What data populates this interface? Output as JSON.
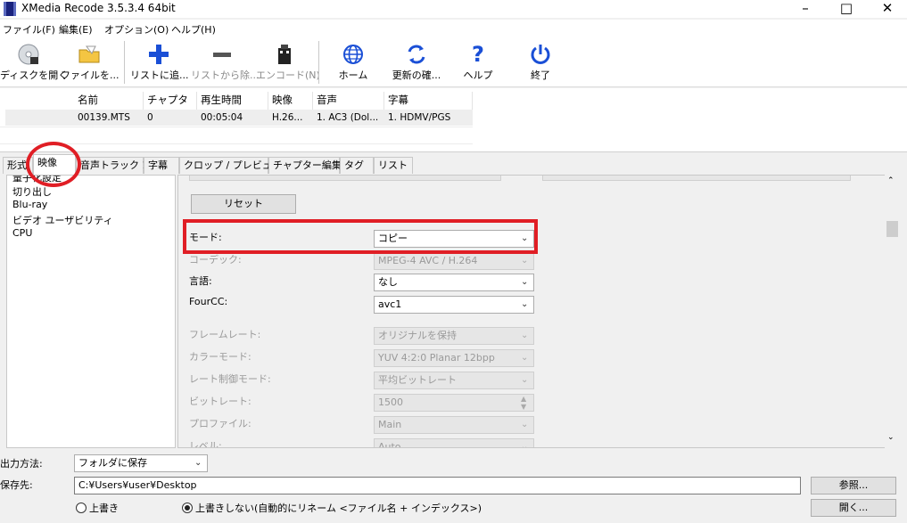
{
  "window": {
    "title": "XMedia Recode 3.5.3.4 64bit"
  },
  "menu": [
    "ファイル(F)",
    "編集(E)",
    "オプション(O)",
    "ヘルプ(H)"
  ],
  "toolbar": {
    "open_disc": "ディスクを開く",
    "open_file": "ファイルを...",
    "add_list": "リストに追...",
    "remove_list": "リストから除...",
    "encode": "エンコード(N)",
    "home": "ホーム",
    "update": "更新の確...",
    "help": "ヘルプ",
    "exit": "終了"
  },
  "filelist": {
    "headers": [
      "名前",
      "チャプター",
      "再生時間",
      "映像",
      "音声",
      "字幕"
    ],
    "row": [
      "00139.MTS",
      "0",
      "00:05:04",
      "H.26...",
      "1. AC3 (Dol...",
      "1. HDMV/PGS"
    ]
  },
  "tabs": [
    "形式",
    "映像",
    "音声トラック 1",
    "字幕",
    "クロップ / プレビュー",
    "チャプター編集",
    "タグ",
    "リスト"
  ],
  "leftpanel": [
    "量子化設定",
    "切り出し",
    "Blu-ray",
    "ビデオ ユーザビリティ",
    "CPU"
  ],
  "video": {
    "reset": "リセット",
    "mode_label": "モード:",
    "mode_value": "コピー",
    "codec_label": "コーデック:",
    "codec_value": "MPEG-4 AVC / H.264",
    "lang_label": "言語:",
    "lang_value": "なし",
    "fourcc_label": "FourCC:",
    "fourcc_value": "avc1",
    "framerate_label": "フレームレート:",
    "framerate_value": "オリジナルを保持",
    "colormode_label": "カラーモード:",
    "colormode_value": "YUV 4:2:0 Planar 12bpp",
    "ratecontrol_label": "レート制御モード:",
    "ratecontrol_value": "平均ビットレート",
    "bitrate_label": "ビットレート:",
    "bitrate_value": "1500",
    "profile_label": "プロファイル:",
    "profile_value": "Main",
    "level_label": "レベル:",
    "level_value": "Auto"
  },
  "output": {
    "method_label": "出力方法:",
    "method_value": "フォルダに保存",
    "dest_label": "保存先:",
    "dest_value": "C:¥Users¥user¥Desktop",
    "browse": "参照...",
    "open": "開く...",
    "overwrite": "上書き",
    "no_overwrite": "上書きしない(自動的にリネーム <ファイル名 + インデックス>)"
  },
  "colors": {
    "annotation": "#e01e25",
    "accent": "#1565c0"
  }
}
